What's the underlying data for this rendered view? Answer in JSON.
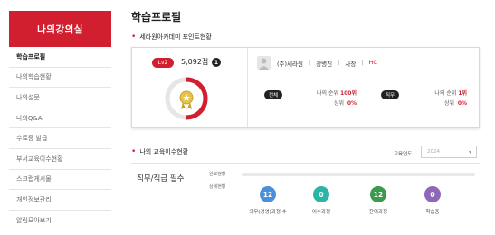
{
  "sidebar": {
    "title": "나의강의실",
    "items": [
      {
        "label": "학습프로필",
        "active": true
      },
      {
        "label": "나의학습현황",
        "active": false
      },
      {
        "label": "나의설문",
        "active": false
      },
      {
        "label": "나의Q&A",
        "active": false
      },
      {
        "label": "수료증 발급",
        "active": false
      },
      {
        "label": "부서교육이수현황",
        "active": false
      },
      {
        "label": "스크랩게시물",
        "active": false
      },
      {
        "label": "개인정보관리",
        "active": false
      },
      {
        "label": "알림모아보기",
        "active": false
      }
    ]
  },
  "main": {
    "title": "학습프로필",
    "point_section_title": "세라원아카데미 포인트현황",
    "level_badge": "Lv2",
    "points": "5,092점",
    "info_label": "1",
    "gauge_fraction": 0.5,
    "user": {
      "company": "(주)세라원",
      "name": "강병진",
      "position": "사장",
      "division": "HC"
    },
    "rank_all": {
      "chip": "전체",
      "rank_label": "나의 순위",
      "rank_value": "100위",
      "top_label": "상위",
      "top_value": "0%"
    },
    "rank_job": {
      "chip": "직무",
      "rank_label": "나의 순위",
      "rank_value": "1위",
      "top_label": "상위",
      "top_value": "0%"
    },
    "edu_section_title": "나의 교육이수현황",
    "year_label": "교육연도",
    "year_value": "2024",
    "job_title": "직무/직급 필수",
    "bar_labels": {
      "done": "완료현황",
      "detail": "상세현황"
    },
    "progress_fraction": 0,
    "stats": [
      {
        "value": "12",
        "label": "의무(경영)과정 수",
        "color": "#4a90d9"
      },
      {
        "value": "0",
        "label": "이수과정",
        "color": "#2cb4a6"
      },
      {
        "value": "12",
        "label": "잔여과정",
        "color": "#3a9b4b"
      },
      {
        "value": "0",
        "label": "학습중",
        "color": "#8e67b8"
      }
    ]
  },
  "colors": {
    "accent": "#d11f2f"
  }
}
